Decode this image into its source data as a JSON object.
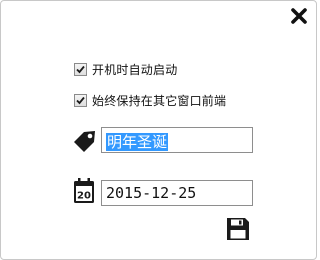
{
  "options": {
    "autostart_label": "开机时自动启动",
    "autostart_checked": true,
    "always_on_top_label": "始终保持在其它窗口前端",
    "always_on_top_checked": true
  },
  "event": {
    "name_value": "明年圣诞",
    "tag_icon": "tag-icon",
    "calendar_icon": "calendar-icon",
    "calendar_day": "20",
    "date_value": "2015-12-25"
  },
  "toolbar": {
    "close_icon": "close-icon",
    "save_icon": "save-icon"
  },
  "colors": {
    "selection": "#3399ff",
    "icon": "#1a1a1a",
    "border": "#8e8e8e"
  }
}
